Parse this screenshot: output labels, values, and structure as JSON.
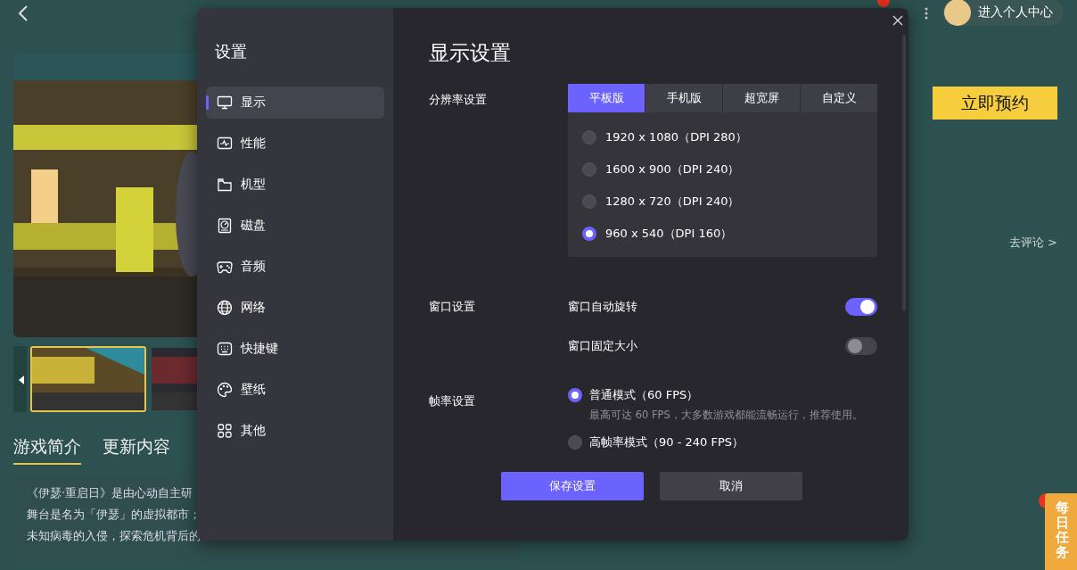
{
  "page": {
    "profile_button": "进入个人中心",
    "reserve_button": "立即预约",
    "review_link": "去评论 >",
    "thumbnails": [
      {
        "selected": true
      },
      {
        "selected": false
      }
    ],
    "tabs": [
      {
        "label": "游戏简介",
        "selected": true
      },
      {
        "label": "更新内容",
        "selected": false
      }
    ],
    "description": [
      "《伊瑟·重启日》是由心动自主研",
      "舞台是名为「伊瑟」的虚拟都市；",
      "未知病毒的入侵，探索危机背后的"
    ],
    "daily_task_badge": "每日任务"
  },
  "dialog": {
    "title": "设置",
    "nav": [
      {
        "label": "显示",
        "selected": true
      },
      {
        "label": "性能",
        "selected": false
      },
      {
        "label": "机型",
        "selected": false
      },
      {
        "label": "磁盘",
        "selected": false
      },
      {
        "label": "音频",
        "selected": false
      },
      {
        "label": "网络",
        "selected": false
      },
      {
        "label": "快捷键",
        "selected": false
      },
      {
        "label": "壁纸",
        "selected": false
      },
      {
        "label": "其他",
        "selected": false
      }
    ],
    "heading": "显示设置",
    "resolution": {
      "label": "分辨率设置",
      "tabs": [
        {
          "label": "平板版",
          "selected": true
        },
        {
          "label": "手机版",
          "selected": false
        },
        {
          "label": "超宽屏",
          "selected": false
        },
        {
          "label": "自定义",
          "selected": false
        }
      ],
      "options": [
        {
          "label": "1920 x 1080（DPI 280）",
          "selected": false
        },
        {
          "label": "1600 x 900（DPI 240）",
          "selected": false
        },
        {
          "label": "1280 x 720（DPI 240）",
          "selected": false
        },
        {
          "label": "960 x 540（DPI 160）",
          "selected": true
        }
      ]
    },
    "window": {
      "label": "窗口设置",
      "toggles": [
        {
          "label": "窗口自动旋转",
          "on": true
        },
        {
          "label": "窗口固定大小",
          "on": false
        }
      ]
    },
    "frame_rate": {
      "label": "帧率设置",
      "options": [
        {
          "label": "普通模式（60 FPS）",
          "hint": "最高可达 60 FPS，大多数游戏都能流畅运行，推荐使用。",
          "selected": true
        },
        {
          "label": "高帧率模式（90 - 240 FPS）",
          "selected": false
        }
      ]
    },
    "buttons": [
      {
        "label": "保存设置",
        "kind": "primary"
      },
      {
        "label": "取消",
        "kind": "secondary"
      }
    ]
  }
}
